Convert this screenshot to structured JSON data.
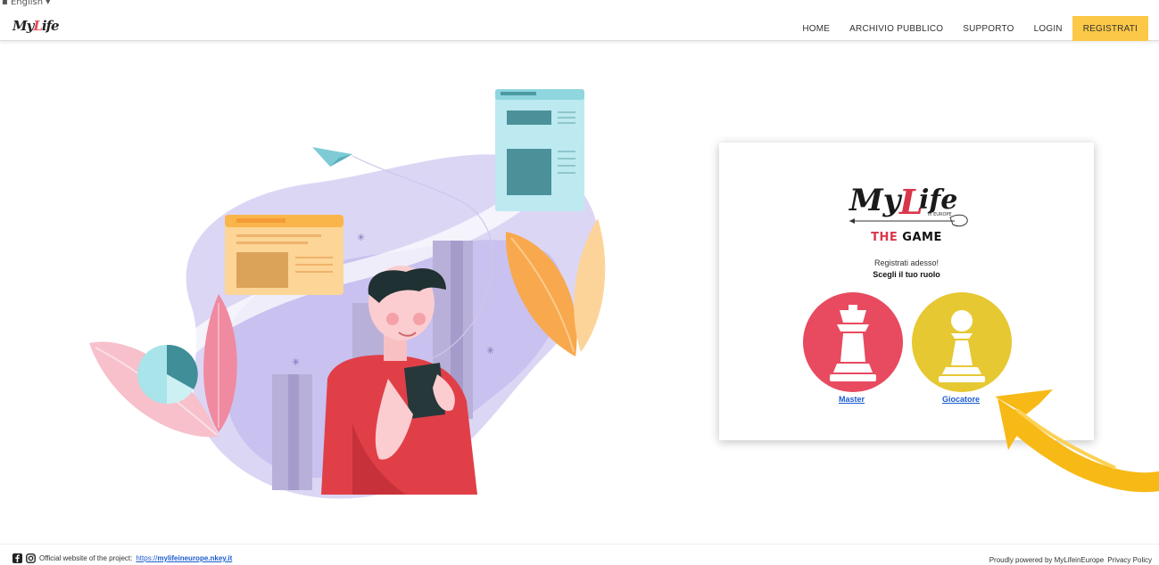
{
  "header": {
    "language": "English",
    "logo_text_1": "My",
    "logo_text_2": "L",
    "logo_text_3": "ife",
    "nav": [
      {
        "label": "HOME"
      },
      {
        "label": "ARCHIVIO PUBBLICO"
      },
      {
        "label": "SUPPORTO"
      },
      {
        "label": "LOGIN"
      },
      {
        "label": "REGISTRATI"
      }
    ]
  },
  "card": {
    "logo_my": "My",
    "logo_l": "L",
    "logo_ife": "ife",
    "logo_in_europe": "in EUROPE",
    "game_the": "THE",
    "game_word": "GAME",
    "subtitle": "Registrati adesso!",
    "choose_role": "Scegli il tuo ruolo",
    "roles": [
      {
        "label": "Master",
        "color": "#e84a5f",
        "icon": "chess-king-icon"
      },
      {
        "label": "Giocatore",
        "color": "#e6c833",
        "icon": "chess-pawn-icon"
      }
    ]
  },
  "footer": {
    "official_text": "Official website of the project:",
    "project_url_prefix": "https://",
    "project_url_domain": "mylifeineurope.nkey.it",
    "powered_by": "Proudly powered by MyLifeinEurope",
    "privacy": "Privacy Policy"
  },
  "colors": {
    "accent_yellow": "#fcc847",
    "master_red": "#e84a5f",
    "player_yellow": "#e6c833",
    "link_blue": "#1a5ccf",
    "arrow_yellow": "#f7b916"
  }
}
